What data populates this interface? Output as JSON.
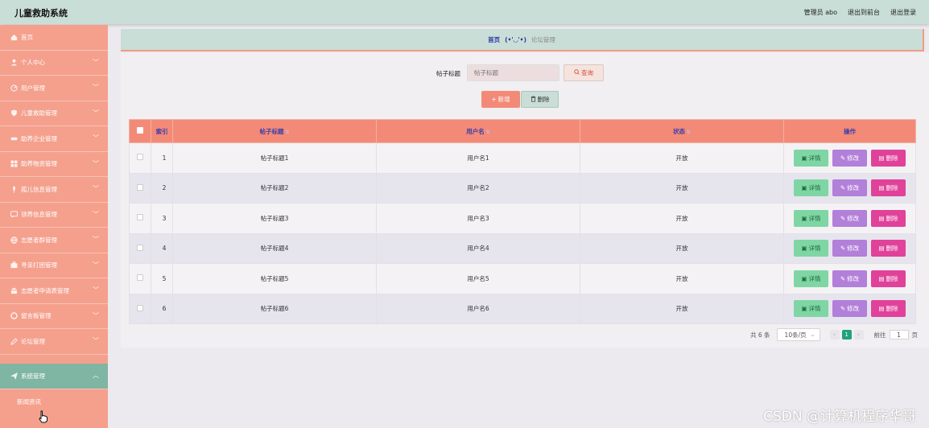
{
  "header": {
    "title": "儿童救助系统",
    "admin": "管理员 abo",
    "back_front": "退出到前台",
    "logout": "退出登录"
  },
  "sidebar": {
    "items": [
      {
        "label": "首页",
        "icon": "home-icon",
        "has_chevron": false
      },
      {
        "label": "个人中心",
        "icon": "user-icon",
        "has_chevron": true
      },
      {
        "label": "用户管理",
        "icon": "gauge-icon",
        "has_chevron": true
      },
      {
        "label": "儿童救助管理",
        "icon": "shield-icon",
        "has_chevron": true
      },
      {
        "label": "助养企业管理",
        "icon": "handshake-icon",
        "has_chevron": true
      },
      {
        "label": "助养物资管理",
        "icon": "grid-icon",
        "has_chevron": true
      },
      {
        "label": "孤儿信息管理",
        "icon": "mic-icon",
        "has_chevron": true
      },
      {
        "label": "领养信息管理",
        "icon": "message-icon",
        "has_chevron": true
      },
      {
        "label": "志愿者群管理",
        "icon": "globe-icon",
        "has_chevron": true
      },
      {
        "label": "寻亲打团管理",
        "icon": "case-icon",
        "has_chevron": true
      },
      {
        "label": "志愿者申请表管理",
        "icon": "bank-icon",
        "has_chevron": true
      },
      {
        "label": "留言板管理",
        "icon": "lifebuoy-icon",
        "has_chevron": true
      },
      {
        "label": "论坛管理",
        "icon": "pen-icon",
        "has_chevron": true
      }
    ],
    "active": {
      "label": "系统管理",
      "icon": "send-icon"
    },
    "sub": "新闻资讯"
  },
  "breadcrumb": {
    "home": "首页",
    "face": "(•'◡'•)",
    "current": "论坛管理"
  },
  "search": {
    "label": "帖子标题",
    "placeholder": "帖子标题",
    "query": "查询"
  },
  "actions": {
    "add": "新增",
    "delete": "删除"
  },
  "table": {
    "headers": {
      "index": "索引",
      "title": "帖子标题",
      "user": "用户名",
      "status": "状态",
      "ops": "操作"
    },
    "rows": [
      {
        "index": "1",
        "title": "帖子标题1",
        "user": "用户名1",
        "status": "开放"
      },
      {
        "index": "2",
        "title": "帖子标题2",
        "user": "用户名2",
        "status": "开放"
      },
      {
        "index": "3",
        "title": "帖子标题3",
        "user": "用户名3",
        "status": "开放"
      },
      {
        "index": "4",
        "title": "帖子标题4",
        "user": "用户名4",
        "status": "开放"
      },
      {
        "index": "5",
        "title": "帖子标题5",
        "user": "用户名5",
        "status": "开放"
      },
      {
        "index": "6",
        "title": "帖子标题6",
        "user": "用户名6",
        "status": "开放"
      }
    ],
    "op_labels": {
      "detail": "详情",
      "edit": "修改",
      "remove": "删除"
    }
  },
  "pager": {
    "total": "共 6 条",
    "size": "10条/页",
    "current": "1",
    "goto": "前往",
    "goto_value": "1",
    "page_unit": "页"
  },
  "watermark": "CSDN @计算机程序华哥",
  "colors": {
    "sidebar": "#f4a08d",
    "header": "#c9ded6",
    "table_head": "#f38a77",
    "detail": "#7fd6a4",
    "edit": "#b27fd9",
    "remove": "#e0429a",
    "active_page": "#1ea37a"
  }
}
